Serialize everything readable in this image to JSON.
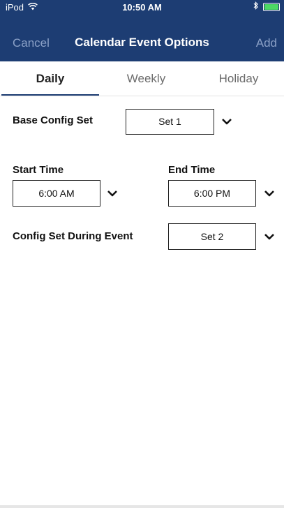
{
  "status_bar": {
    "carrier": "iPod",
    "time": "10:50 AM",
    "wifi_icon": "wifi-icon",
    "bluetooth_icon": "bluetooth-icon",
    "battery_icon": "battery-charging-icon",
    "battery_color": "#4cd964"
  },
  "nav": {
    "cancel_label": "Cancel",
    "title": "Calendar Event Options",
    "add_label": "Add",
    "bar_color": "#1d3d73"
  },
  "tabs": [
    {
      "label": "Daily",
      "active": true
    },
    {
      "label": "Weekly",
      "active": false
    },
    {
      "label": "Holiday",
      "active": false
    }
  ],
  "form": {
    "base_config": {
      "label": "Base Config Set",
      "value": "Set 1"
    },
    "start_time": {
      "label": "Start Time",
      "value": "6:00 AM"
    },
    "end_time": {
      "label": "End Time",
      "value": "6:00 PM"
    },
    "event_config": {
      "label": "Config Set During Event",
      "value": "Set 2"
    }
  }
}
